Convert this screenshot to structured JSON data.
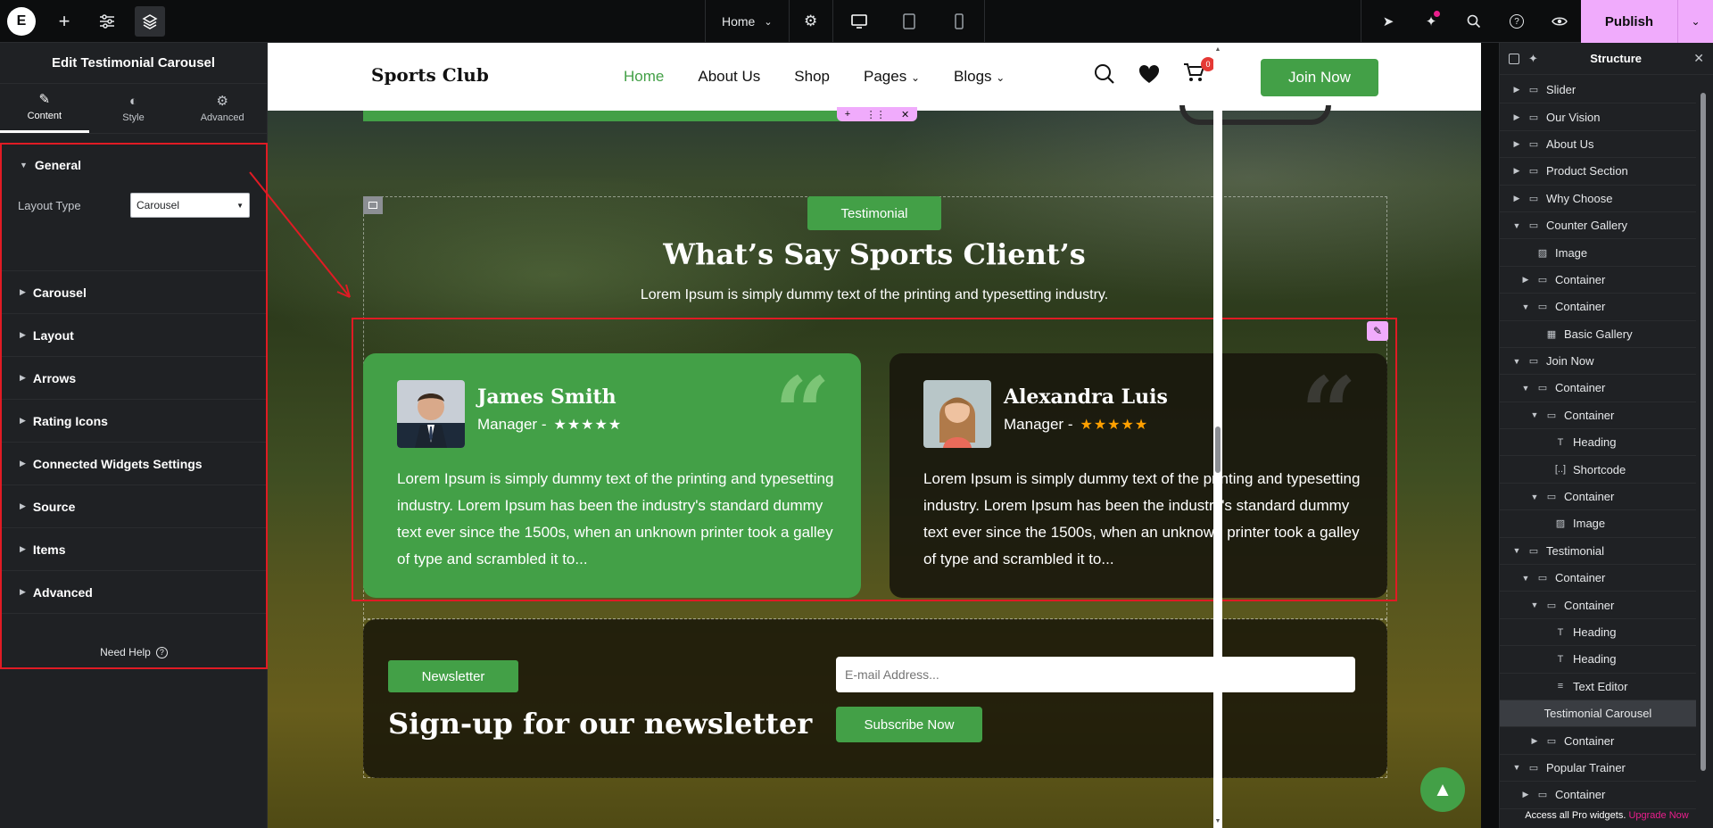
{
  "topbar": {
    "logo": "E",
    "page_label": "Home",
    "publish_label": "Publish"
  },
  "panel": {
    "title": "Edit Testimonial Carousel",
    "tabs": [
      {
        "label": "Content",
        "icon": "pencil-icon"
      },
      {
        "label": "Style",
        "icon": "contrast-icon"
      },
      {
        "label": "Advanced",
        "icon": "gear-icon"
      }
    ],
    "general": {
      "title": "General",
      "layout_type_label": "Layout Type",
      "layout_type_value": "Carousel"
    },
    "sections": [
      "Carousel",
      "Layout",
      "Arrows",
      "Rating Icons",
      "Connected Widgets Settings",
      "Source",
      "Items",
      "Advanced"
    ],
    "need_help": "Need Help"
  },
  "site": {
    "brand": "Sports Club",
    "nav": [
      "Home",
      "About Us",
      "Shop",
      "Pages",
      "Blogs"
    ],
    "cart_count": "0",
    "join_label": "Join Now",
    "testimonial_pill": "Testimonial",
    "title": "What’s Say Sports Client’s",
    "subtitle": "Lorem Ipsum is simply dummy text of the printing and typesetting industry.",
    "cards": [
      {
        "name": "James Smith",
        "role": "Manager -",
        "rating": 5,
        "text": "Lorem Ipsum is simply dummy text of the printing and typesetting industry. Lorem Ipsum has been the industry's standard dummy text ever since the 1500s, when an unknown printer took a galley of type and scrambled it to..."
      },
      {
        "name": "Alexandra Luis",
        "role": "Manager -",
        "rating": 5,
        "text": "Lorem Ipsum is simply dummy text of the printing and typesetting industry. Lorem Ipsum has been the industry's standard dummy text ever since the 1500s, when an unknown printer took a galley of type and scrambled it to..."
      }
    ],
    "newsletter_pill": "Newsletter",
    "newsletter_title": "Sign-up for our newsletter",
    "email_placeholder": "E-mail Address...",
    "subscribe_label": "Subscribe Now"
  },
  "structure": {
    "title": "Structure",
    "items": [
      {
        "label": "Slider",
        "depth": 0,
        "caret": "right",
        "icon": "container-icon"
      },
      {
        "label": "Our Vision",
        "depth": 0,
        "caret": "right",
        "icon": "container-icon"
      },
      {
        "label": "About Us",
        "depth": 0,
        "caret": "right",
        "icon": "container-icon"
      },
      {
        "label": "Product Section",
        "depth": 0,
        "caret": "right",
        "icon": "container-icon"
      },
      {
        "label": "Why Choose",
        "depth": 0,
        "caret": "right",
        "icon": "container-icon"
      },
      {
        "label": "Counter Gallery",
        "depth": 0,
        "caret": "down",
        "icon": "container-icon"
      },
      {
        "label": "Image",
        "depth": 1,
        "caret": "none",
        "icon": "image-icon"
      },
      {
        "label": "Container",
        "depth": 1,
        "caret": "right",
        "icon": "container-icon"
      },
      {
        "label": "Container",
        "depth": 1,
        "caret": "down",
        "icon": "container-icon"
      },
      {
        "label": "Basic Gallery",
        "depth": 2,
        "caret": "none",
        "icon": "gallery-icon"
      },
      {
        "label": "Join Now",
        "depth": 0,
        "caret": "down",
        "icon": "container-icon"
      },
      {
        "label": "Container",
        "depth": 1,
        "caret": "down",
        "icon": "container-icon"
      },
      {
        "label": "Container",
        "depth": 2,
        "caret": "down",
        "icon": "container-icon"
      },
      {
        "label": "Heading",
        "depth": 3,
        "caret": "none",
        "icon": "heading-icon"
      },
      {
        "label": "Shortcode",
        "depth": 3,
        "caret": "none",
        "icon": "shortcode-icon"
      },
      {
        "label": "Container",
        "depth": 2,
        "caret": "down",
        "icon": "container-icon"
      },
      {
        "label": "Image",
        "depth": 3,
        "caret": "none",
        "icon": "image-icon"
      },
      {
        "label": "Testimonial",
        "depth": 0,
        "caret": "down",
        "icon": "container-icon"
      },
      {
        "label": "Container",
        "depth": 1,
        "caret": "down",
        "icon": "container-icon"
      },
      {
        "label": "Container",
        "depth": 2,
        "caret": "down",
        "icon": "container-icon"
      },
      {
        "label": "Heading",
        "depth": 3,
        "caret": "none",
        "icon": "heading-icon"
      },
      {
        "label": "Heading",
        "depth": 3,
        "caret": "none",
        "icon": "heading-icon"
      },
      {
        "label": "Text Editor",
        "depth": 3,
        "caret": "none",
        "icon": "text-editor-icon"
      },
      {
        "label": "Testimonial Carousel",
        "depth": 3,
        "caret": "none",
        "icon": "none",
        "selected": true
      },
      {
        "label": "Container",
        "depth": 2,
        "caret": "right",
        "icon": "container-icon"
      },
      {
        "label": "Popular Trainer",
        "depth": 0,
        "caret": "down",
        "icon": "container-icon"
      },
      {
        "label": "Container",
        "depth": 1,
        "caret": "right",
        "icon": "container-icon"
      }
    ],
    "upgrade_text": "Access all Pro widgets.",
    "upgrade_link": "Upgrade Now"
  },
  "colors": {
    "accent_green": "#43a047",
    "publish_pink": "#f0abfc",
    "selection_red": "#e01b24",
    "star_orange": "#ffa000",
    "upgrade_pink": "#e91e8c"
  }
}
